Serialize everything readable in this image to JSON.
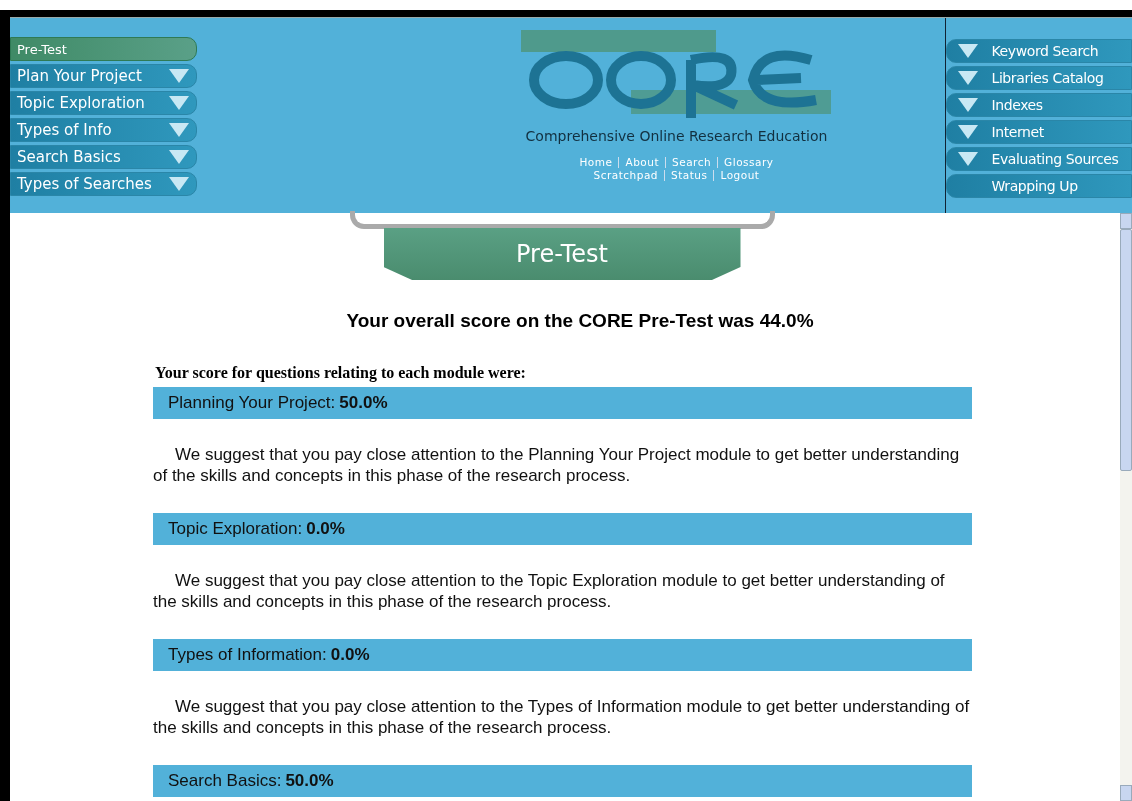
{
  "left_nav": [
    {
      "label": "Pre-Test",
      "selected": true,
      "kind": "plain"
    },
    {
      "label": "Plan Your Project",
      "selected": false,
      "kind": "dropdown"
    },
    {
      "label": "Topic Exploration",
      "selected": false,
      "kind": "dropdown"
    },
    {
      "label": "Types of Info",
      "selected": false,
      "kind": "dropdown"
    },
    {
      "label": "Search Basics",
      "selected": false,
      "kind": "dropdown"
    },
    {
      "label": "Types of Searches",
      "selected": false,
      "kind": "dropdown"
    }
  ],
  "logo": {
    "tagline": "Comprehensive Online Research Education"
  },
  "links": [
    [
      "Home",
      "About",
      "Search",
      "Glossary"
    ],
    [
      "Scratchpad",
      "Status",
      "Logout"
    ]
  ],
  "right_nav": [
    {
      "label": "Keyword Search",
      "kind": "dropdown"
    },
    {
      "label": "Libraries Catalog",
      "kind": "dropdown"
    },
    {
      "label": "Indexes",
      "kind": "dropdown"
    },
    {
      "label": "Internet",
      "kind": "dropdown"
    },
    {
      "label": "Evaluating Sources",
      "kind": "dropdown"
    },
    {
      "label": "Wrapping Up",
      "kind": "plain"
    }
  ],
  "page_tab": "Pre-Test",
  "overall": "Your overall score on the CORE Pre-Test was 44.0%",
  "intro": "Your score for questions relating to each module were:",
  "modules": [
    {
      "label": "Planning Your Project:",
      "score": "50.0%",
      "suggestion": "We suggest that you pay close attention to the Planning Your Project module to get better understanding of the skills and concepts in this phase of the research process."
    },
    {
      "label": "Topic Exploration:",
      "score": "0.0%",
      "suggestion": "We suggest that you pay close attention to the Topic Exploration module to get better understanding of the skills and concepts in this phase of the research process."
    },
    {
      "label": "Types of Information:",
      "score": "0.0%",
      "suggestion": "We suggest that you pay close attention to the Types of Information module to get better understanding of the skills and concepts in this phase of the research process."
    },
    {
      "label": "Search Basics:",
      "score": "50.0%"
    }
  ]
}
